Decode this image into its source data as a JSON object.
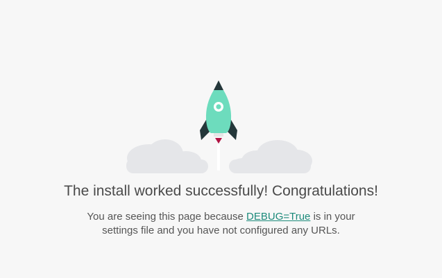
{
  "headline": "The install worked successfully! Congratulations!",
  "message": {
    "before_link": "You are seeing this page because ",
    "link_text": "DEBUG=True",
    "after_link": " is in your",
    "line2": "settings file and you have not configured any URLs."
  },
  "icons": {
    "rocket": "rocket-icon",
    "clouds": "cloud-icon"
  },
  "colors": {
    "rocket_body": "#6ddcbd",
    "rocket_dark": "#24373a",
    "flame": "#b11242",
    "cloud": "#e5e6e9",
    "link": "#1b8a7a"
  }
}
